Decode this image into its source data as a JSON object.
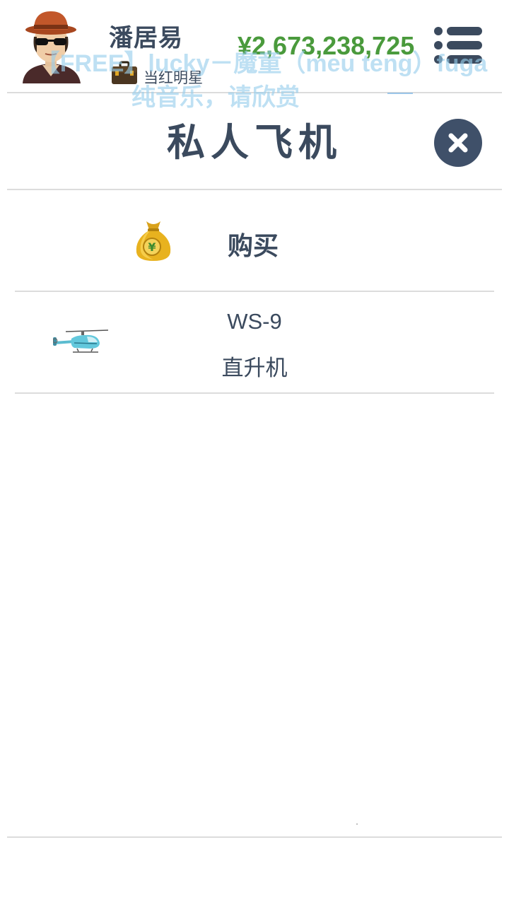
{
  "header": {
    "player_name": "潘居易",
    "job_title": "当红明星",
    "money": "¥2,673,238,725",
    "avatar_icon": "avatar-icon",
    "job_icon": "briefcase-icon",
    "menu_icon": "menu-list-icon"
  },
  "music_overlay": {
    "title": "【FREE】lucky－魔童（meu teng）fuga",
    "subtitle": "纯音乐，请欣赏"
  },
  "panel": {
    "title": "私人飞机",
    "close_icon": "close-icon"
  },
  "buy": {
    "label": "购买",
    "icon": "money-bag-icon"
  },
  "items": [
    {
      "model": "WS-9",
      "type": "直升机",
      "icon": "helicopter-icon"
    }
  ],
  "colors": {
    "text": "#3b4a5e",
    "money": "#4a9a3c",
    "overlay": "#96cdeb",
    "close_bg": "#3f5069",
    "divider": "#dcdcdc"
  }
}
